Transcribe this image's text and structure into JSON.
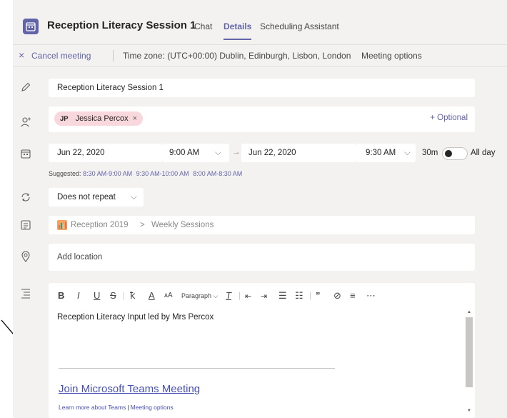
{
  "header": {
    "title": "Reception Literacy Session 1",
    "tabs": [
      {
        "label": "Chat"
      },
      {
        "label": "Details"
      },
      {
        "label": "Scheduling Assistant"
      }
    ]
  },
  "commandbar": {
    "cancel_label": "Cancel meeting",
    "timezone": "Time zone: (UTC+00:00) Dublin, Edinburgh, Lisbon, London",
    "meeting_options": "Meeting options"
  },
  "form": {
    "title_value": "Reception Literacy Session 1",
    "attendee": {
      "initials": "JP",
      "name": "Jessica Percox",
      "remove": "×"
    },
    "optional_label": "+ Optional",
    "start_date": "Jun 22, 2020",
    "start_time": "9:00 AM",
    "arrow": "→",
    "end_date": "Jun 22, 2020",
    "end_time": "9:30 AM",
    "duration": "30m",
    "all_day_label": "All day",
    "suggested_label": "Suggested:",
    "suggested_times": [
      "8:30 AM-9:00 AM",
      "9:30 AM-10:00 AM",
      "8:00 AM-8:30 AM"
    ],
    "repeat": "Does not repeat",
    "channel_team": "Reception 2019",
    "channel_sep": ">",
    "channel_name": "Weekly Sessions",
    "location_placeholder": "Add location"
  },
  "editor": {
    "paragraph_label": "Paragraph",
    "body": "Reception Literacy Input led by Mrs Percox",
    "join_link": "Join Microsoft Teams Meeting",
    "learn_more": "Learn more about Teams",
    "link_sep": "|",
    "options_link": "Meeting options"
  },
  "colors": {
    "accent": "#6264a7",
    "link": "#464eb8",
    "attendee_chip": "#f8d8dc",
    "background": "#f3f2f1"
  }
}
